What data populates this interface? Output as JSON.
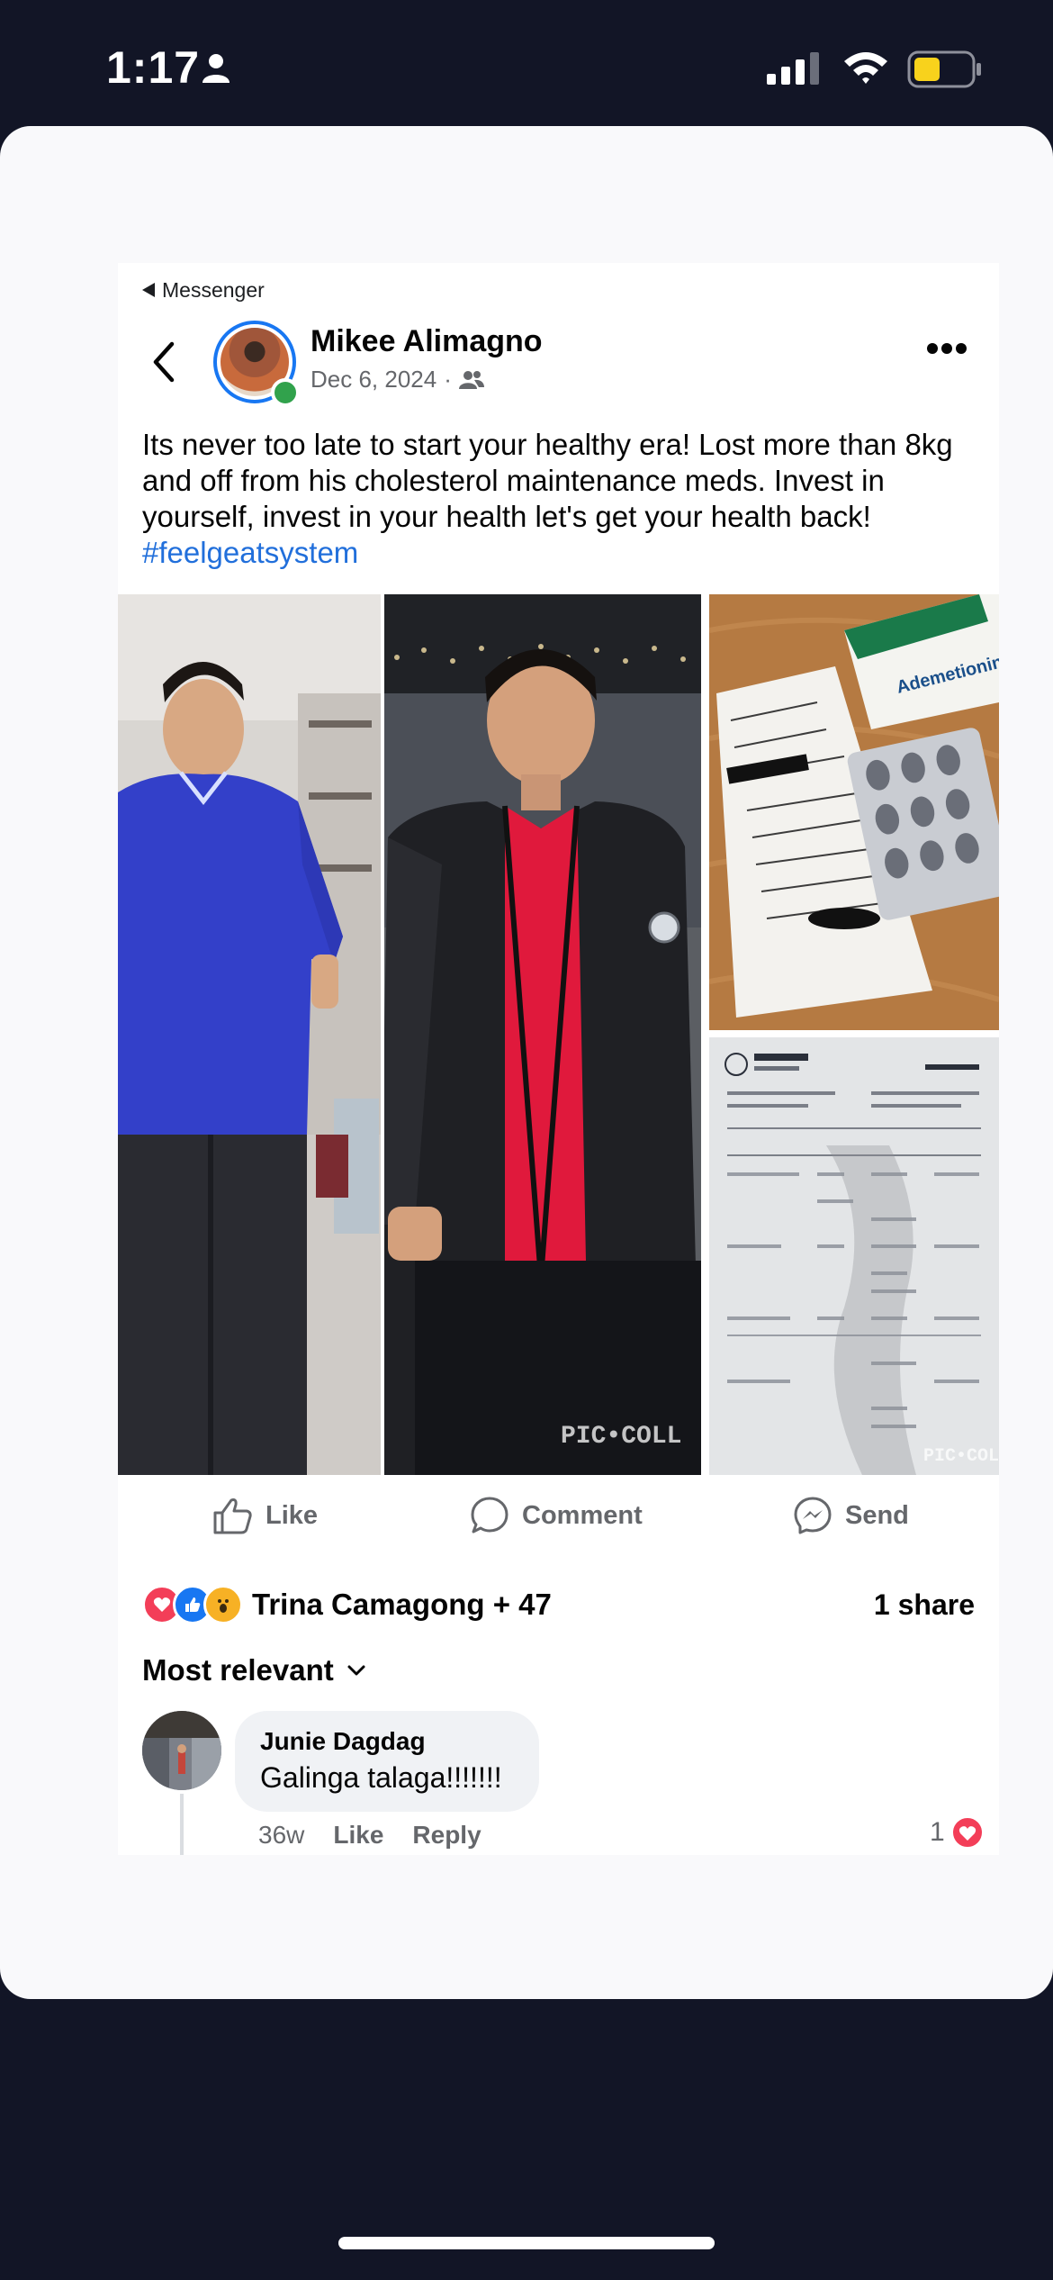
{
  "status": {
    "time": "1:17"
  },
  "header": {
    "back_label": "Messenger"
  },
  "post": {
    "author": "Mikee Alimagno",
    "date": "Dec 6, 2024",
    "separator": "·",
    "text": "Its never too late to start your healthy era! Lost more than 8kg and off from his cholesterol maintenance meds. Invest in yourself, invest in your health let's get your health back!",
    "hashtag": "#feelgeatsystem",
    "watermark_main": "PIC•COLL",
    "watermark_side": "PIC•COL",
    "pill_brand": "Ademetionine Transmetil"
  },
  "actions": {
    "like": "Like",
    "comment": "Comment",
    "send": "Send"
  },
  "engagement": {
    "reactors": "Trina Camagong + 47",
    "shares": "1 share"
  },
  "comments": {
    "sort_label": "Most relevant",
    "items": [
      {
        "author": "Junie Dagdag",
        "text": "Galinga talaga!!!!!!!",
        "age": "36w",
        "like": "Like",
        "reply": "Reply",
        "reaction_count": "1"
      }
    ]
  },
  "colors": {
    "accent": "#1877f2",
    "link": "#216fdb",
    "online": "#31a24c",
    "love": "#f33e58",
    "bg": "#121526"
  }
}
